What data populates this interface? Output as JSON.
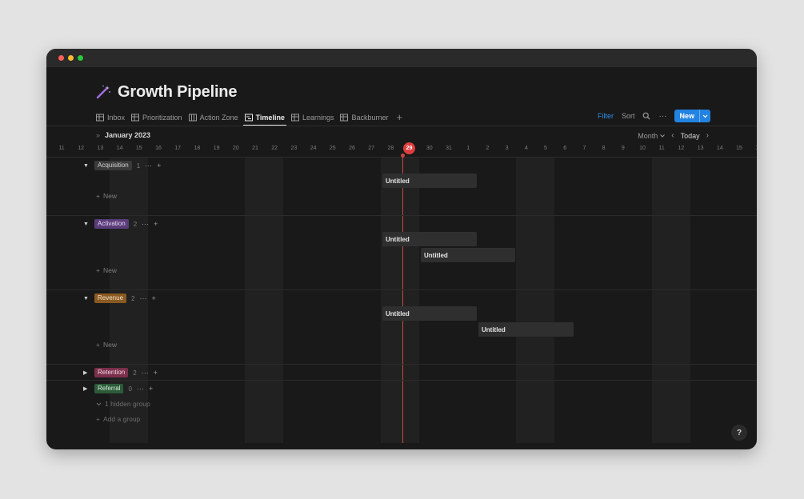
{
  "page": {
    "title": "Growth Pipeline"
  },
  "tabs": [
    {
      "label": "Inbox",
      "icon": "table-icon",
      "active": false
    },
    {
      "label": "Prioritization",
      "icon": "table-icon",
      "active": false
    },
    {
      "label": "Action Zone",
      "icon": "board-icon",
      "active": false
    },
    {
      "label": "Timeline",
      "icon": "timeline-icon",
      "active": true
    },
    {
      "label": "Learnings",
      "icon": "table-icon",
      "active": false
    },
    {
      "label": "Backburner",
      "icon": "table-icon",
      "active": false
    }
  ],
  "toolbar": {
    "filter": "Filter",
    "sort": "Sort",
    "new": "New"
  },
  "timeline": {
    "month": "January 2023",
    "scale": "Month",
    "today_label": "Today",
    "days": [
      "11",
      "12",
      "13",
      "14",
      "15",
      "16",
      "17",
      "18",
      "19",
      "20",
      "21",
      "22",
      "23",
      "24",
      "25",
      "26",
      "27",
      "28",
      "29",
      "30",
      "31",
      "1",
      "2",
      "3",
      "4",
      "5",
      "6",
      "7",
      "8",
      "9",
      "10",
      "11",
      "12",
      "13",
      "14",
      "15",
      "16"
    ],
    "today": "29"
  },
  "groups": [
    {
      "name": "Acquisition",
      "count": "1",
      "expanded": true,
      "tag_bg": "#3a3a3a",
      "tag_fg": "#d6d6d6",
      "items": [
        {
          "title": "Untitled"
        }
      ],
      "new_label": "New"
    },
    {
      "name": "Activation",
      "count": "2",
      "expanded": true,
      "tag_bg": "#5a3c7a",
      "tag_fg": "#e8dcf5",
      "items": [
        {
          "title": "Untitled"
        },
        {
          "title": "Untitled"
        }
      ],
      "new_label": "New"
    },
    {
      "name": "Revenue",
      "count": "2",
      "expanded": true,
      "tag_bg": "#8a5a22",
      "tag_fg": "#f5e3c8",
      "items": [
        {
          "title": "Untitled"
        },
        {
          "title": "Untitled"
        }
      ],
      "new_label": "New"
    },
    {
      "name": "Retention",
      "count": "2",
      "expanded": false,
      "tag_bg": "#7a2f4b",
      "tag_fg": "#f5d6e2"
    },
    {
      "name": "Referral",
      "count": "0",
      "expanded": false,
      "tag_bg": "#2d5a3a",
      "tag_fg": "#d3f0dc"
    }
  ],
  "footer": {
    "hidden_group": "1 hidden group",
    "add_group": "Add a group",
    "help": "?"
  },
  "colors": {
    "accent": "#2383e2",
    "today": "#e03e3e"
  }
}
